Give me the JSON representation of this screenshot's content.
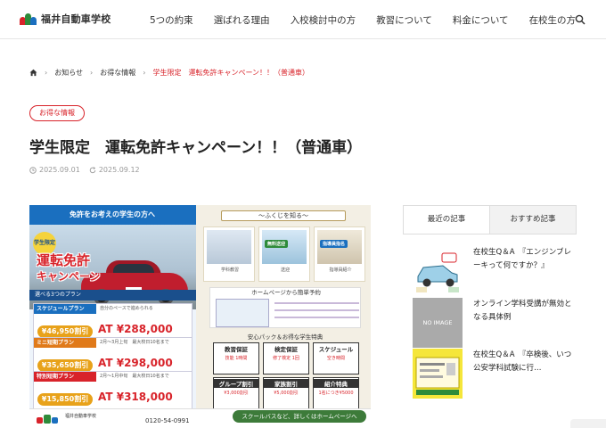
{
  "brand": {
    "name": "福井自動車学校",
    "colors": {
      "red": "#d8232a",
      "green": "#2e8b3a",
      "blue": "#1a6fbf"
    }
  },
  "nav": {
    "items": [
      "5つの約束",
      "選ばれる理由",
      "入校検討中の方",
      "教習について",
      "料金について",
      "在校生の方"
    ],
    "search_icon": "search-icon"
  },
  "breadcrumb": {
    "home_icon": "home-icon",
    "items": [
      "お知らせ",
      "お得な情報"
    ],
    "current": "学生限定　運転免許キャンペーン！！（普通車）"
  },
  "article": {
    "category": "お得な情報",
    "title": "学生限定　運転免許キャンペーン！！（普通車）",
    "published": "2025.09.01",
    "updated": "2025.09.12"
  },
  "hero": {
    "banner": "免許をお考えの学生の方へ",
    "badge": "学生限定",
    "headline_1": "運転免許",
    "headline_2": "キャンペーン",
    "plan_header": "選べる3つのプラン",
    "plans": [
      {
        "name": "スケジュールプラン",
        "note": "自分のペースで進められる",
        "price": "¥46,950割引",
        "result": "AT ¥288,000",
        "color": "#1a6fbf"
      },
      {
        "name": "ミニ短期プラン",
        "note": "2月～3月上旬　最大校日10名まで",
        "price": "¥35,650割引",
        "result": "AT ¥298,000",
        "color": "#e07a1a"
      },
      {
        "name": "特別短期プラン",
        "note": "2月～1月中旬　最大校日10名まで",
        "price": "¥15,850割引",
        "result": "AT ¥318,000",
        "color": "#d8232a"
      }
    ],
    "right_title": "～ふくじを知る～",
    "card_captions": [
      "学科教習",
      "送迎",
      "指導員紹介"
    ],
    "card_badges": [
      "無料送迎",
      "指導員指名",
      "¥5000"
    ],
    "hp_title": "ホームページから簡単予約",
    "anshin_title": "安心パック＆お得な学生特典",
    "tiles": [
      {
        "title": "教習保証",
        "line": "技能 1時間"
      },
      {
        "title": "検定保証",
        "line": "修了検定 1回"
      },
      {
        "title": "スケジュール",
        "line": "空き時間"
      },
      {
        "title": "グループ割引",
        "line": "¥3,000割引"
      },
      {
        "title": "家族割引",
        "line": "¥5,000割引"
      },
      {
        "title": "紹介特典",
        "line": "1名につき¥5000"
      }
    ],
    "footer_school": "福井自動車学校",
    "tel": "0120-54-0991",
    "bus_note": "スクールバスなど、詳しくはホームページへ"
  },
  "sidebar": {
    "tabs": [
      "最近の記事",
      "おすすめ記事"
    ],
    "active_tab": 0,
    "posts": [
      {
        "title": "在校生Q＆A　『エンジンブレーキって何ですか？』",
        "thumb": "car-illustration"
      },
      {
        "title": "オンライン学科受講が無効となる具体例",
        "thumb": "NO IMAGE"
      },
      {
        "title": "在校生Q＆A　『卒検後、いつ公安学科試験に行…",
        "thumb": "license-card"
      }
    ]
  }
}
